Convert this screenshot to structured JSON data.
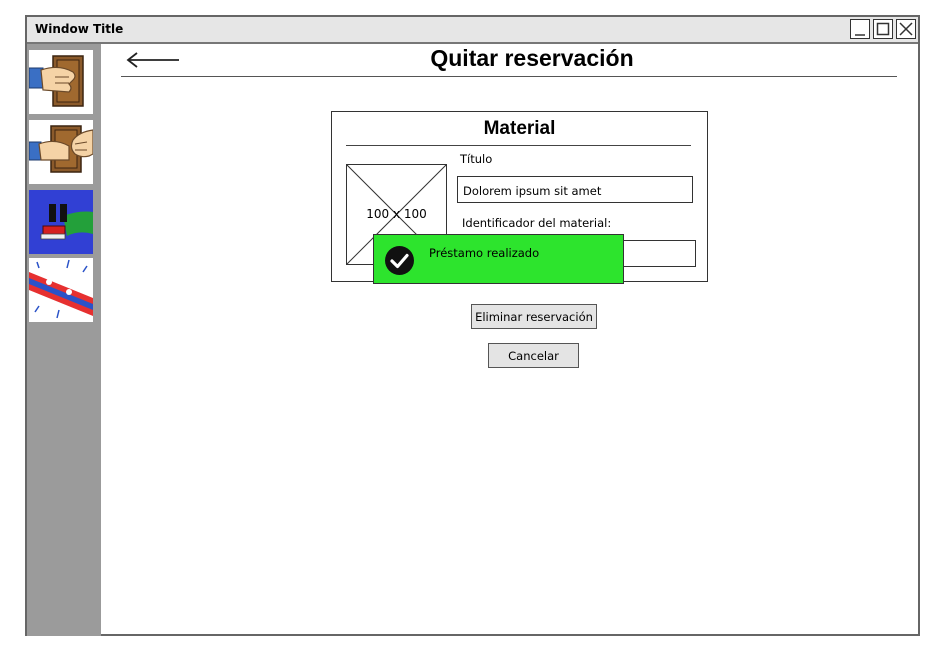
{
  "window": {
    "title": "Window Title",
    "controls": [
      "minimize-icon",
      "maximize-icon",
      "close-icon"
    ]
  },
  "sidebar": {
    "items": [
      {
        "id": "prestar",
        "icon": "hand-giving-book-icon"
      },
      {
        "id": "devolver",
        "icon": "hands-returning-book-icon"
      },
      {
        "id": "reservar",
        "icon": "pause-book-icon"
      },
      {
        "id": "quitar-reserva",
        "icon": "reservation-tape-icon"
      }
    ]
  },
  "header": {
    "back_icon": "back-arrow-icon",
    "title": "Quitar reservación"
  },
  "material": {
    "heading": "Material",
    "image_placeholder": "100 x 100",
    "title_label": "Título",
    "title_value": "Dolorem ipsum sit amet",
    "id_label": "Identificador del material:",
    "id_value": ""
  },
  "toast": {
    "icon": "check-circle-icon",
    "message": "Préstamo realizado",
    "color": "#2de42d"
  },
  "actions": {
    "remove_label": "Eliminar reservación",
    "cancel_label": "Cancelar"
  },
  "colors": {
    "sidebar": "#9b9b9b",
    "titlebar": "#e6e6e6",
    "button": "#e4e4e4"
  }
}
